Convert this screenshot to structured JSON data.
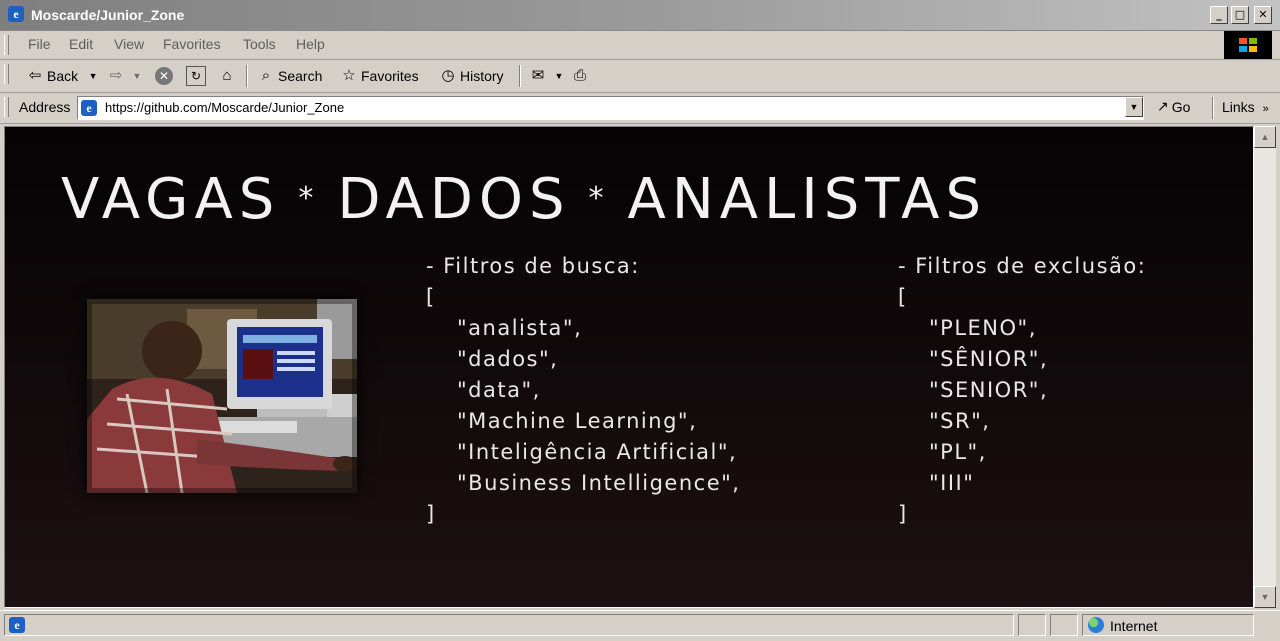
{
  "window": {
    "title": "Moscarde/Junior_Zone",
    "buttons": [
      "_",
      "□",
      "✕"
    ]
  },
  "menu": [
    "File",
    "Edit",
    "View",
    "Favorites",
    "Tools",
    "Help"
  ],
  "toolbar": {
    "back": "Back",
    "search": "Search",
    "favorites": "Favorites",
    "history": "History"
  },
  "address": {
    "label": "Address",
    "url": "https://github.com/Moscarde/Junior_Zone",
    "go": "Go",
    "links": "Links"
  },
  "page": {
    "headline": [
      "VAGAS",
      "DADOS",
      "ANALISTAS"
    ],
    "separator": "*",
    "search_filters": {
      "title": "- Filtros de busca:",
      "open": "[",
      "items": [
        "\"analista\",",
        "\"dados\",",
        "\"data\",",
        "\"Machine Learning\",",
        "\"Inteligência Artificial\",",
        "\"Business Intelligence\","
      ],
      "close": "]"
    },
    "exclusion_filters": {
      "title": "- Filtros de exclusão:",
      "open": "[",
      "items": [
        "\"PLENO\",",
        "\"SÊNIOR\",",
        "\"SENIOR\",",
        "\"SR\",",
        "\"PL\",",
        "\"III\""
      ],
      "close": "]"
    }
  },
  "status": {
    "zone": "Internet"
  }
}
